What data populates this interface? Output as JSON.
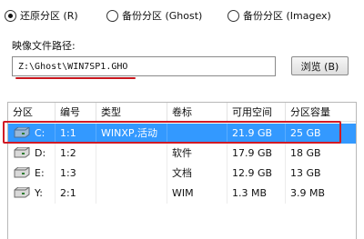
{
  "mode_options": [
    {
      "label": "还原分区 (R)",
      "selected": true
    },
    {
      "label": "备份分区 (Ghost)",
      "selected": false
    },
    {
      "label": "备份分区 (Imagex)",
      "selected": false
    }
  ],
  "image_path": {
    "label": "映像文件路径:",
    "value": "Z:\\Ghost\\WIN7SP1.GHO",
    "browse_label": "浏览 (B)"
  },
  "table": {
    "headers": [
      "分区",
      "编号",
      "类型",
      "卷标",
      "可用空间",
      "分区容量"
    ],
    "rows": [
      {
        "part": "C:",
        "num": "1:1",
        "type": "WINXP,活动",
        "vol": "",
        "free": "21.9 GB",
        "cap": "25 GB",
        "selected": true
      },
      {
        "part": "D:",
        "num": "1:2",
        "type": "",
        "vol": "软件",
        "free": "17.9 GB",
        "cap": "18 GB",
        "selected": false
      },
      {
        "part": "E:",
        "num": "1:3",
        "type": "",
        "vol": "文档",
        "free": "12.9 GB",
        "cap": "13 GB",
        "selected": false
      },
      {
        "part": "Y:",
        "num": "2:1",
        "type": "",
        "vol": "WIM",
        "free": "1.3 MB",
        "cap": "3.9 MB",
        "selected": false
      }
    ]
  },
  "colors": {
    "selection": "#3399ff",
    "highlight_annotation": "#d11a24"
  },
  "icons": {
    "drive": "hard-drive-icon"
  }
}
